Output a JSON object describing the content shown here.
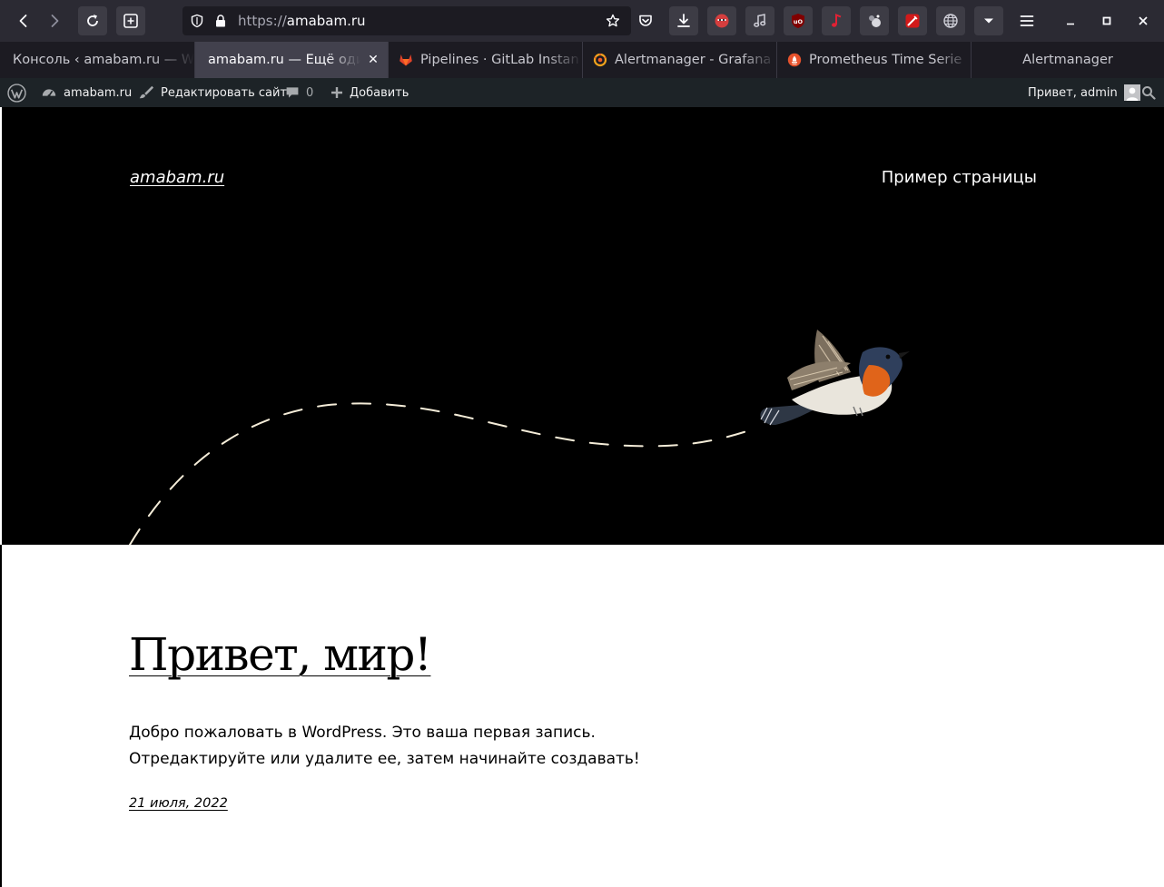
{
  "browser": {
    "url_scheme": "https://",
    "url_host": "amabam.ru",
    "tabs": [
      {
        "label": "Консоль ‹ amabam.ru — W",
        "active": false,
        "favicon": "wordpress-icon"
      },
      {
        "label": "amabam.ru — Ещё оди",
        "active": true,
        "favicon": "none"
      },
      {
        "label": "Pipelines · GitLab Instan",
        "active": false,
        "favicon": "gitlab-icon"
      },
      {
        "label": "Alertmanager - Grafana",
        "active": false,
        "favicon": "grafana-icon"
      },
      {
        "label": "Prometheus Time Serie",
        "active": false,
        "favicon": "prometheus-icon"
      },
      {
        "label": "Alertmanager",
        "active": false,
        "favicon": "none"
      }
    ],
    "colors": {
      "toolbar": "#2b2a33",
      "tabstrip": "#1c1b22",
      "active_tab": "#42414d"
    }
  },
  "adminbar": {
    "site_name": "amabam.ru",
    "edit_site": "Редактировать сайт",
    "comments_count": "0",
    "add_new": "Добавить",
    "greeting": "Привет, admin"
  },
  "site": {
    "title": "amabam.ru",
    "nav": [
      "Пример страницы"
    ]
  },
  "post": {
    "title": "Привет, мир!",
    "body": "Добро пожаловать в WordPress. Это ваша первая запись. Отредактируйте или удалите ее, затем начинайте создавать!",
    "date": "21 июля, 2022"
  }
}
